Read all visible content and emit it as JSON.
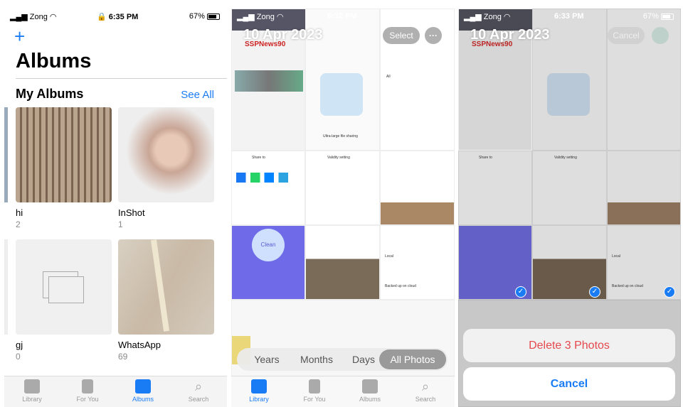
{
  "left": {
    "status": {
      "carrier": "Zong",
      "time": "6:35 PM",
      "battery": "67%"
    },
    "add_icon": "plus-icon",
    "title": "Albums",
    "section_title": "My Albums",
    "see_all": "See All",
    "albums": [
      {
        "name": "hi",
        "count": "2"
      },
      {
        "name": "InShot",
        "count": "1"
      },
      {
        "name": "gj",
        "count": "0"
      },
      {
        "name": "WhatsApp",
        "count": "69"
      }
    ],
    "tabs": [
      "Library",
      "For You",
      "Albums",
      "Search"
    ],
    "active_tab": "Albums"
  },
  "middle": {
    "status": {
      "carrier": "Zong",
      "time": "6:32 PM",
      "battery": "67%"
    },
    "date": "10 Apr 2023",
    "select": "Select",
    "more": "···",
    "thumbnail_text": {
      "news": "SSPNews90",
      "share": "Share to",
      "validity": "Validity setting",
      "clean": "Clean",
      "backup": "Backed up on cloud",
      "local": "Local",
      "all": "All",
      "file_sharing": "Ultra-large file sharing"
    },
    "segments": [
      "Years",
      "Months",
      "Days",
      "All Photos"
    ],
    "active_segment": "All Photos",
    "tabs": [
      "Library",
      "For You",
      "Albums",
      "Search"
    ],
    "active_tab": "Library"
  },
  "right": {
    "status": {
      "carrier": "Zong",
      "time": "6:33 PM",
      "battery": "67%"
    },
    "date": "10 Apr 2023",
    "cancel_top": "Cancel",
    "thumbnail_text": {
      "news": "SSPNews90",
      "share": "Share to",
      "validity": "Validity setting",
      "backup": "Backed up on cloud",
      "local": "Local"
    },
    "delete": "Delete 3 Photos",
    "cancel": "Cancel",
    "selected_count": 3,
    "colors": {
      "accent": "#1a7cf5",
      "destructive": "#e5484d"
    }
  }
}
